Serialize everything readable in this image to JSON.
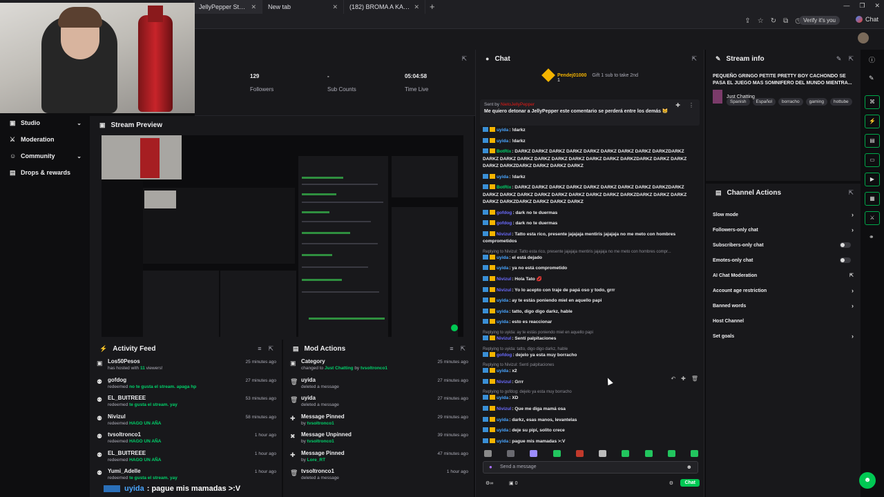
{
  "browser": {
    "tabs": [
      {
        "label": "JellyPepper Stream - Watch Live o"
      },
      {
        "label": "New tab"
      },
      {
        "label": "(182) BROMA A KAMILO LO DISFR"
      }
    ],
    "verify_label": "Verify it's you",
    "chat_label": "Chat"
  },
  "sidebar": {
    "items": [
      {
        "label": "Studio",
        "icon": "video-icon",
        "chevron": true
      },
      {
        "label": "Moderation",
        "icon": "sword-icon",
        "chevron": false
      },
      {
        "label": "Community",
        "icon": "people-icon",
        "chevron": true
      },
      {
        "label": "Drops & rewards",
        "icon": "gift-icon",
        "chevron": false
      }
    ]
  },
  "stats": [
    {
      "value": "129",
      "label": "Followers"
    },
    {
      "value": "-",
      "label": "Sub Counts"
    },
    {
      "value": "05:04:58",
      "label": "Time Live"
    }
  ],
  "preview": {
    "title": "Stream Preview"
  },
  "activity_feed": {
    "title": "Activity Feed",
    "items": [
      {
        "name": "Los50Pesos",
        "sub_pre": "has hosted with ",
        "sub_hl": "11",
        "sub_post": " viewers!",
        "time": "25 minutes ago",
        "icon": "host-icon"
      },
      {
        "name": "gofdog",
        "sub_pre": "redeemed ",
        "sub_hl": "no te gusta el stream. apaga hp",
        "sub_post": "",
        "time": "27 minutes ago",
        "icon": "reward-icon"
      },
      {
        "name": "EL_BUITREEE",
        "sub_pre": "redeemed ",
        "sub_hl": "te gusta el stream. yay",
        "sub_post": "",
        "time": "53 minutes ago",
        "icon": "reward-icon"
      },
      {
        "name": "Nivizul",
        "sub_pre": "redeemed ",
        "sub_hl": "HAGO UN AÑA",
        "sub_post": "",
        "time": "58 minutes ago",
        "icon": "reward-icon"
      },
      {
        "name": "tvsoltronco1",
        "sub_pre": "redeemed ",
        "sub_hl": "HAGO UN AÑA",
        "sub_post": "",
        "time": "1 hour ago",
        "icon": "reward-icon"
      },
      {
        "name": "EL_BUITREEE",
        "sub_pre": "redeemed ",
        "sub_hl": "HAGO UN AÑA",
        "sub_post": "",
        "time": "1 hour ago",
        "icon": "reward-icon"
      },
      {
        "name": "Yumi_Adelle",
        "sub_pre": "redeemed ",
        "sub_hl": "te gusta el stream. yay",
        "sub_post": "",
        "time": "1 hour ago",
        "icon": "reward-icon"
      }
    ]
  },
  "mod_actions": {
    "title": "Mod Actions",
    "items": [
      {
        "name": "Category",
        "sub_pre": "changed to ",
        "sub_hl": "Just Chatting",
        "sub_post": " by ",
        "sub_hl2": "tvsoltronco1",
        "time": "25 minutes ago",
        "icon": "category-icon"
      },
      {
        "name": "uyida",
        "sub_pre": "deleted a message",
        "sub_hl": "",
        "sub_post": "",
        "sub_hl2": "",
        "time": "27 minutes ago",
        "icon": "trash-icon"
      },
      {
        "name": "uyida",
        "sub_pre": "deleted a message",
        "sub_hl": "",
        "sub_post": "",
        "sub_hl2": "",
        "time": "27 minutes ago",
        "icon": "trash-icon"
      },
      {
        "name": "Message Pinned",
        "sub_pre": "by ",
        "sub_hl": "tvsoltronco1",
        "sub_post": "",
        "sub_hl2": "",
        "time": "29 minutes ago",
        "icon": "pin-icon"
      },
      {
        "name": "Message Unpinned",
        "sub_pre": "by ",
        "sub_hl": "tvsoltronco1",
        "sub_post": "",
        "sub_hl2": "",
        "time": "39 minutes ago",
        "icon": "unpin-icon"
      },
      {
        "name": "Message Pinned",
        "sub_pre": "by ",
        "sub_hl": "Lore_RT",
        "sub_post": "",
        "sub_hl2": "",
        "time": "47 minutes ago",
        "icon": "pin-icon"
      },
      {
        "name": "tvsoltronco1",
        "sub_pre": "deleted a message",
        "sub_hl": "",
        "sub_post": "",
        "sub_hl2": "",
        "time": "1 hour ago",
        "icon": "trash-icon"
      }
    ]
  },
  "caption": {
    "user": "uyida",
    "text": ": pague mis mamadas >:V"
  },
  "chat": {
    "title": "Chat",
    "gift": {
      "name": "Pendej01000",
      "count": "1",
      "text": "Gift 1 sub to take 2nd"
    },
    "pinned": {
      "by_label": "Sent by",
      "by_name": "NietoJellyPepper",
      "message": "Me quiero detonar a JellyPepper este comentario se perderá entre los demás 😸"
    },
    "lines": [
      {
        "reply": "",
        "user": "uyida",
        "color": "#4aa6ff",
        "text": ": !darkz"
      },
      {
        "reply": "",
        "user": "uyida",
        "color": "#4aa6ff",
        "text": ": !darkz"
      },
      {
        "reply": "",
        "user": "BotRix",
        "color": "#00d26a",
        "text": ": DARKZ DARKZ DARKZ DARKZ DARKZ DARKZ DARKZ DARKZ DARKZDARKZ DARKZ DARKZ DARKZ DARKZ DARKZ DARKZ DARKZ DARKZ DARKZDARKZ DARKZ DARKZ DARKZ DARKZDARKZ DARKZ DARKZ DARKZ"
      },
      {
        "reply": "",
        "user": "uyida",
        "color": "#4aa6ff",
        "text": ": !darkz"
      },
      {
        "reply": "",
        "user": "BotRix",
        "color": "#00d26a",
        "text": ": DARKZ DARKZ DARKZ DARKZ DARKZ DARKZ DARKZ DARKZ DARKZDARKZ DARKZ DARKZ DARKZ DARKZ DARKZ DARKZ DARKZ DARKZ DARKZDARKZ DARKZ DARKZ DARKZ DARKZDARKZ DARKZ DARKZ DARKZ"
      },
      {
        "reply": "",
        "user": "gofdog",
        "color": "#6b6bff",
        "text": ": dark no te duermas"
      },
      {
        "reply": "",
        "user": "gofdog",
        "color": "#6b6bff",
        "text": ": dark no te duermas"
      },
      {
        "reply": "",
        "user": "Nivizul",
        "color": "#6b6bff",
        "text": ": Tatto esta rico, presente jajajaja mentiris jajajaja no me meto con hombres comprometidos"
      },
      {
        "reply": "Replying to Nivizul: Tatto esta rico, presente jajajaja mentiris jajajaja no me meto con hombres compr...",
        "user": "uyida",
        "color": "#4aa6ff",
        "text": ": el está dejado"
      },
      {
        "reply": "",
        "user": "uyida",
        "color": "#4aa6ff",
        "text": ": ya no está comprometido"
      },
      {
        "reply": "",
        "user": "Nivizul",
        "color": "#6b6bff",
        "text": ": Hola Tato 💋"
      },
      {
        "reply": "",
        "user": "Nivizul",
        "color": "#6b6bff",
        "text": ": Yo lo acepto con traje de papá oso y todo, grrr"
      },
      {
        "reply": "",
        "user": "uyida",
        "color": "#4aa6ff",
        "text": ": ay te estás poniendo miel en aquello papi"
      },
      {
        "reply": "",
        "user": "uyida",
        "color": "#4aa6ff",
        "text": ": tatto, digo digo darkz, hable"
      },
      {
        "reply": "",
        "user": "uyida",
        "color": "#4aa6ff",
        "text": ": esto es reaccionar"
      },
      {
        "reply": "Replying to uyida: ay te estás poniendo miel en aquello papi",
        "user": "Nivizul",
        "color": "#6b6bff",
        "text": ": Sentí palpitaciones"
      },
      {
        "reply": "Replying to uyida: tatto, digo digo darkz, hable",
        "user": "gofdog",
        "color": "#6b6bff",
        "text": ": dejelo ya esta muy borracho"
      },
      {
        "reply": "Replying to Nivizul: Sentí palpitaciones",
        "user": "uyida",
        "color": "#4aa6ff",
        "text": ": x2"
      },
      {
        "reply": "",
        "user": "Nivizul",
        "color": "#6b6bff",
        "text": ": Grrr"
      },
      {
        "reply": "Replying to gofdog: dejelo ya esta muy borracho",
        "user": "uyida",
        "color": "#4aa6ff",
        "text": ": XD"
      },
      {
        "reply": "",
        "user": "Nivizul",
        "color": "#6b6bff",
        "text": ": Que me diga mamá osa"
      },
      {
        "reply": "",
        "user": "uyida",
        "color": "#4aa6ff",
        "text": ": darkz, esas manos, levantelas"
      },
      {
        "reply": "",
        "user": "uyida",
        "color": "#4aa6ff",
        "text": ": deje su pipí, solito crece"
      },
      {
        "reply": "",
        "user": "uyida",
        "color": "#4aa6ff",
        "text": ": pague mis mamadas >:V"
      }
    ],
    "input_placeholder": "Send a message",
    "points_count": "0",
    "send_label": "Chat"
  },
  "stream_info": {
    "title": "Stream info",
    "stream_title": "PEQUEÑO GRINGO PETITE PRETTY BOY CACHONDO SE PASA EL JUEGO MAS SOMNIFERO DEL MUNDO MIENTRA...",
    "category": "Just Chatting",
    "tags": [
      "Spanish",
      "Español",
      "borracho",
      "gaming",
      "hottube"
    ]
  },
  "channel_actions": {
    "title": "Channel Actions",
    "items": [
      {
        "label": "Slow mode",
        "control": "chevron"
      },
      {
        "label": "Followers-only chat",
        "control": "chevron"
      },
      {
        "label": "Subscribers-only chat",
        "control": "toggle"
      },
      {
        "label": "Emotes-only chat",
        "control": "toggle"
      },
      {
        "label": "AI Chat Moderation",
        "control": "external"
      },
      {
        "label": "Account age restriction",
        "control": "chevron"
      },
      {
        "label": "Banned words",
        "control": "chevron"
      },
      {
        "label": "Host Channel",
        "control": "none"
      },
      {
        "label": "Set goals",
        "control": "chevron"
      }
    ]
  },
  "colors": {
    "accent": "#00c853",
    "bg": "#0e0e10",
    "panel": "#18181b",
    "highlight": "#00d26a"
  }
}
